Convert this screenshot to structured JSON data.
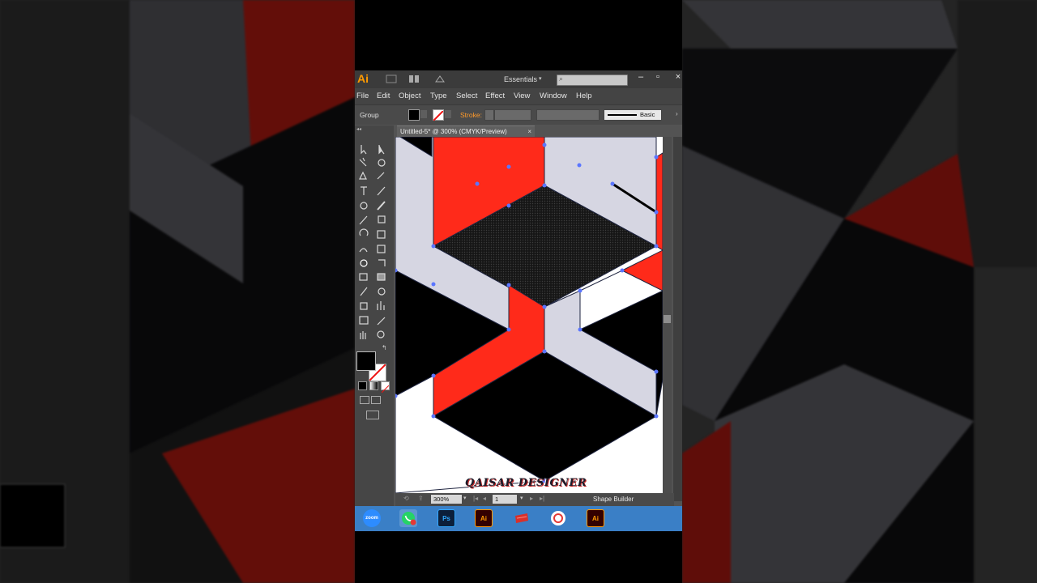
{
  "app": {
    "logo": "Ai",
    "workspace": "Essentials",
    "window_controls": [
      "minimize-icon",
      "maximize-icon",
      "close-icon"
    ]
  },
  "menu": [
    "File",
    "Edit",
    "Object",
    "Type",
    "Select",
    "Effect",
    "View",
    "Window",
    "Help"
  ],
  "control_bar": {
    "selection_label": "Group",
    "stroke_label": "Stroke:",
    "stroke_profile": "Basic"
  },
  "document": {
    "tab_title": "Untitled-5* @ 300% (CMYK/Preview)",
    "tab_close": "×"
  },
  "status_bar": {
    "zoom": "300%",
    "page": "1",
    "current_tool": "Shape Builder"
  },
  "watermark": "QAISAR DESIGNER",
  "taskbar": [
    {
      "name": "zoom",
      "label": "zoom"
    },
    {
      "name": "whatsapp",
      "label": ""
    },
    {
      "name": "photoshop",
      "label": "Ps"
    },
    {
      "name": "illustrator",
      "label": "Ai"
    },
    {
      "name": "app-red",
      "label": ""
    },
    {
      "name": "app-circle",
      "label": ""
    },
    {
      "name": "illustrator-active",
      "label": "Ai"
    }
  ],
  "colors": {
    "red": "#ff2a1a",
    "light_gray": "#d6d6e2",
    "black": "#000000",
    "selection": "#5b76ff",
    "accent": "#ff9a00",
    "taskbar": "#3a7fc6"
  }
}
